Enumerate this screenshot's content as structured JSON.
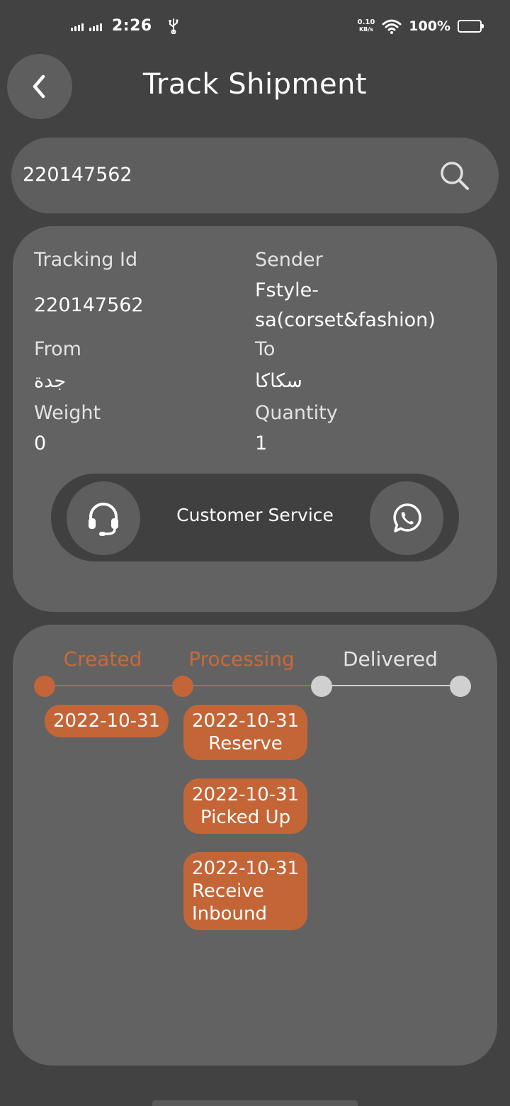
{
  "status_bar": {
    "time": "2:26",
    "net_speed_value": "0.10",
    "net_speed_unit": "KB/s",
    "battery": "100%"
  },
  "header": {
    "title": "Track Shipment",
    "back_icon": "chevron-left-icon"
  },
  "search": {
    "value": "220147562",
    "icon": "search-icon"
  },
  "shipment": {
    "tracking_id_label": "Tracking Id",
    "tracking_id": "220147562",
    "sender_label": "Sender",
    "sender_line1": "Fstyle-",
    "sender_line2": "sa(corset&fashion)",
    "from_label": "From",
    "from_value": "جدة",
    "to_label": "To",
    "to_value": "سكاكا",
    "weight_label": "Weight",
    "weight_value": "0",
    "quantity_label": "Quantity",
    "quantity_value": "1"
  },
  "customer_service": {
    "label": "Customer Service",
    "headset_icon": "headset-icon",
    "whatsapp_icon": "whatsapp-icon"
  },
  "timeline": {
    "stages": [
      {
        "label": "Created",
        "status": "done"
      },
      {
        "label": "Processing",
        "status": "done"
      },
      {
        "label": "Delivered",
        "status": "pending"
      }
    ],
    "created_events": [
      {
        "date": "2022-10-31"
      }
    ],
    "processing_events": [
      {
        "date": "2022-10-31",
        "line1": "Reserve"
      },
      {
        "date": "2022-10-31",
        "line1": "Picked Up"
      },
      {
        "date": "2022-10-31",
        "line1": "Receive",
        "line2": "Inbound"
      }
    ]
  },
  "colors": {
    "background": "#424242",
    "card": "#626262",
    "accent": "#c46537",
    "pending": "#d0d0d0"
  }
}
